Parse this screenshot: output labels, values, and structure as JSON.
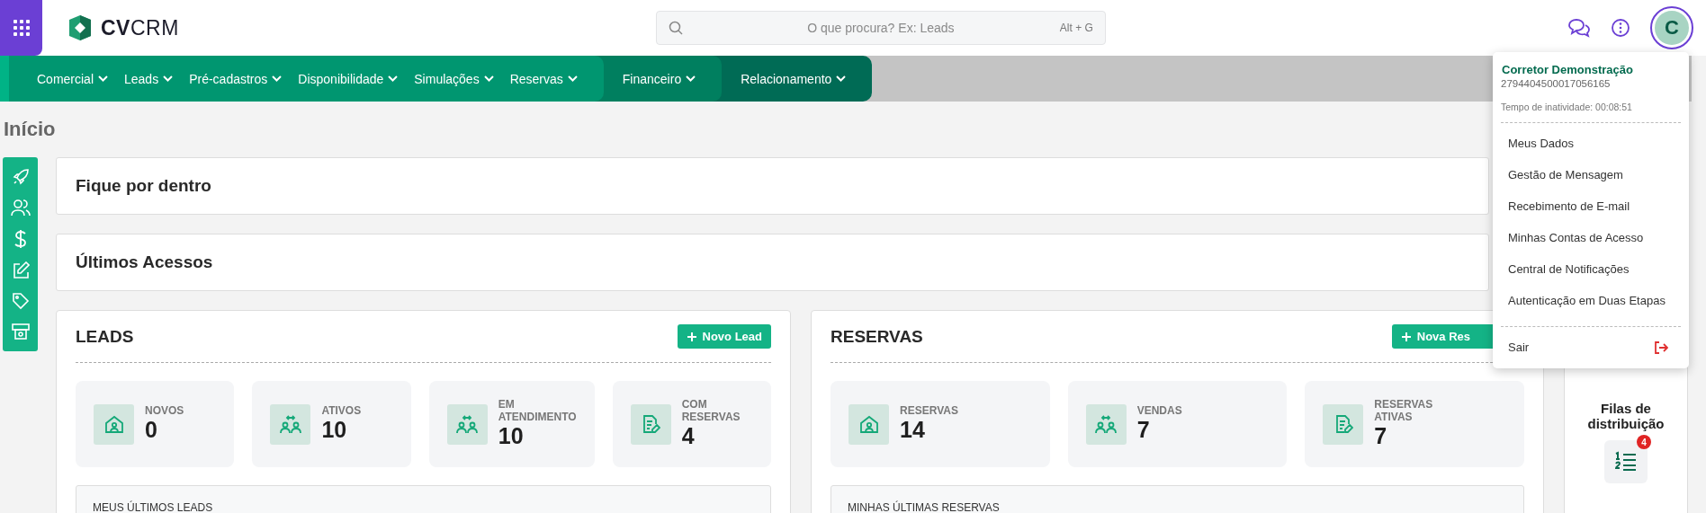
{
  "top_bar": {
    "logo": "**CV**CRM",
    "search": {
      "placeholder": "O que procura? Ex: Leads",
      "shortcut": "Alt + G"
    },
    "avatar": "C"
  },
  "nav": [
    {
      "color": "#009670",
      "items": [
        "Comercial",
        "Leads",
        "Pré-cadastros",
        "Disponibilidade",
        "Simulações",
        "Reservas"
      ]
    },
    {
      "color": "#007f5f",
      "items": [
        "Financeiro"
      ]
    },
    {
      "color": "#006b55",
      "items": [
        "Relacionamento"
      ]
    }
  ],
  "page_title": "Início",
  "panels": [
    {
      "title": "Fique por dentro"
    },
    {
      "title": "Últimos Acessos"
    }
  ],
  "leads": {
    "title": "LEADS",
    "button": "Novo Lead",
    "stats": [
      {
        "kind": "house",
        "label": "NOVOS",
        "value": "0"
      },
      {
        "kind": "exchange",
        "label": "ATIVOS",
        "value": "10"
      },
      {
        "kind": "exchange",
        "label": "EM ATENDIMENTO",
        "value": "10"
      },
      {
        "kind": "document",
        "label": "COM RESERVAS",
        "value": "4"
      }
    ],
    "list_title": "MEUS ÚLTIMOS LEADS"
  },
  "reservas": {
    "title": "RESERVAS",
    "button": "Nova Res",
    "stats": [
      {
        "kind": "house",
        "label": "RESERVAS",
        "value": "14"
      },
      {
        "kind": "exchange",
        "label": "VENDAS",
        "value": "7"
      },
      {
        "kind": "document",
        "label": "RESERVAS ATIVAS",
        "value": "7"
      }
    ],
    "list_title": "MINHAS ÚLTIMAS RESERVAS"
  },
  "queues": {
    "title": "Filas de distribuição",
    "badge": "4"
  },
  "user_menu": {
    "name": "Corretor Demonstração",
    "id": "2794404500017056165",
    "idle": "Tempo de inatividade: 00:08:51",
    "items": [
      "Meus Dados",
      "Gestão de Mensagem",
      "Recebimento de E-mail",
      "Minhas Contas de Acesso",
      "Central de Notificações",
      "Autenticação em Duas Etapas"
    ],
    "logout": "Sair"
  }
}
